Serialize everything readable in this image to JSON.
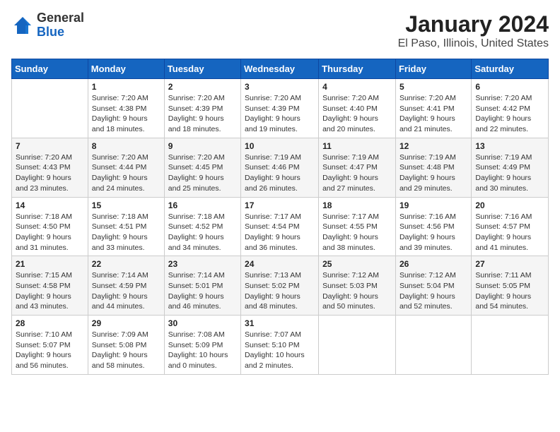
{
  "header": {
    "logo": {
      "general": "General",
      "blue": "Blue"
    },
    "title": "January 2024",
    "subtitle": "El Paso, Illinois, United States"
  },
  "weekdays": [
    "Sunday",
    "Monday",
    "Tuesday",
    "Wednesday",
    "Thursday",
    "Friday",
    "Saturday"
  ],
  "weeks": [
    [
      {
        "day": "",
        "sunrise": "",
        "sunset": "",
        "daylight": ""
      },
      {
        "day": "1",
        "sunrise": "Sunrise: 7:20 AM",
        "sunset": "Sunset: 4:38 PM",
        "daylight": "Daylight: 9 hours and 18 minutes."
      },
      {
        "day": "2",
        "sunrise": "Sunrise: 7:20 AM",
        "sunset": "Sunset: 4:39 PM",
        "daylight": "Daylight: 9 hours and 18 minutes."
      },
      {
        "day": "3",
        "sunrise": "Sunrise: 7:20 AM",
        "sunset": "Sunset: 4:39 PM",
        "daylight": "Daylight: 9 hours and 19 minutes."
      },
      {
        "day": "4",
        "sunrise": "Sunrise: 7:20 AM",
        "sunset": "Sunset: 4:40 PM",
        "daylight": "Daylight: 9 hours and 20 minutes."
      },
      {
        "day": "5",
        "sunrise": "Sunrise: 7:20 AM",
        "sunset": "Sunset: 4:41 PM",
        "daylight": "Daylight: 9 hours and 21 minutes."
      },
      {
        "day": "6",
        "sunrise": "Sunrise: 7:20 AM",
        "sunset": "Sunset: 4:42 PM",
        "daylight": "Daylight: 9 hours and 22 minutes."
      }
    ],
    [
      {
        "day": "7",
        "sunrise": "Sunrise: 7:20 AM",
        "sunset": "Sunset: 4:43 PM",
        "daylight": "Daylight: 9 hours and 23 minutes."
      },
      {
        "day": "8",
        "sunrise": "Sunrise: 7:20 AM",
        "sunset": "Sunset: 4:44 PM",
        "daylight": "Daylight: 9 hours and 24 minutes."
      },
      {
        "day": "9",
        "sunrise": "Sunrise: 7:20 AM",
        "sunset": "Sunset: 4:45 PM",
        "daylight": "Daylight: 9 hours and 25 minutes."
      },
      {
        "day": "10",
        "sunrise": "Sunrise: 7:19 AM",
        "sunset": "Sunset: 4:46 PM",
        "daylight": "Daylight: 9 hours and 26 minutes."
      },
      {
        "day": "11",
        "sunrise": "Sunrise: 7:19 AM",
        "sunset": "Sunset: 4:47 PM",
        "daylight": "Daylight: 9 hours and 27 minutes."
      },
      {
        "day": "12",
        "sunrise": "Sunrise: 7:19 AM",
        "sunset": "Sunset: 4:48 PM",
        "daylight": "Daylight: 9 hours and 29 minutes."
      },
      {
        "day": "13",
        "sunrise": "Sunrise: 7:19 AM",
        "sunset": "Sunset: 4:49 PM",
        "daylight": "Daylight: 9 hours and 30 minutes."
      }
    ],
    [
      {
        "day": "14",
        "sunrise": "Sunrise: 7:18 AM",
        "sunset": "Sunset: 4:50 PM",
        "daylight": "Daylight: 9 hours and 31 minutes."
      },
      {
        "day": "15",
        "sunrise": "Sunrise: 7:18 AM",
        "sunset": "Sunset: 4:51 PM",
        "daylight": "Daylight: 9 hours and 33 minutes."
      },
      {
        "day": "16",
        "sunrise": "Sunrise: 7:18 AM",
        "sunset": "Sunset: 4:52 PM",
        "daylight": "Daylight: 9 hours and 34 minutes."
      },
      {
        "day": "17",
        "sunrise": "Sunrise: 7:17 AM",
        "sunset": "Sunset: 4:54 PM",
        "daylight": "Daylight: 9 hours and 36 minutes."
      },
      {
        "day": "18",
        "sunrise": "Sunrise: 7:17 AM",
        "sunset": "Sunset: 4:55 PM",
        "daylight": "Daylight: 9 hours and 38 minutes."
      },
      {
        "day": "19",
        "sunrise": "Sunrise: 7:16 AM",
        "sunset": "Sunset: 4:56 PM",
        "daylight": "Daylight: 9 hours and 39 minutes."
      },
      {
        "day": "20",
        "sunrise": "Sunrise: 7:16 AM",
        "sunset": "Sunset: 4:57 PM",
        "daylight": "Daylight: 9 hours and 41 minutes."
      }
    ],
    [
      {
        "day": "21",
        "sunrise": "Sunrise: 7:15 AM",
        "sunset": "Sunset: 4:58 PM",
        "daylight": "Daylight: 9 hours and 43 minutes."
      },
      {
        "day": "22",
        "sunrise": "Sunrise: 7:14 AM",
        "sunset": "Sunset: 4:59 PM",
        "daylight": "Daylight: 9 hours and 44 minutes."
      },
      {
        "day": "23",
        "sunrise": "Sunrise: 7:14 AM",
        "sunset": "Sunset: 5:01 PM",
        "daylight": "Daylight: 9 hours and 46 minutes."
      },
      {
        "day": "24",
        "sunrise": "Sunrise: 7:13 AM",
        "sunset": "Sunset: 5:02 PM",
        "daylight": "Daylight: 9 hours and 48 minutes."
      },
      {
        "day": "25",
        "sunrise": "Sunrise: 7:12 AM",
        "sunset": "Sunset: 5:03 PM",
        "daylight": "Daylight: 9 hours and 50 minutes."
      },
      {
        "day": "26",
        "sunrise": "Sunrise: 7:12 AM",
        "sunset": "Sunset: 5:04 PM",
        "daylight": "Daylight: 9 hours and 52 minutes."
      },
      {
        "day": "27",
        "sunrise": "Sunrise: 7:11 AM",
        "sunset": "Sunset: 5:05 PM",
        "daylight": "Daylight: 9 hours and 54 minutes."
      }
    ],
    [
      {
        "day": "28",
        "sunrise": "Sunrise: 7:10 AM",
        "sunset": "Sunset: 5:07 PM",
        "daylight": "Daylight: 9 hours and 56 minutes."
      },
      {
        "day": "29",
        "sunrise": "Sunrise: 7:09 AM",
        "sunset": "Sunset: 5:08 PM",
        "daylight": "Daylight: 9 hours and 58 minutes."
      },
      {
        "day": "30",
        "sunrise": "Sunrise: 7:08 AM",
        "sunset": "Sunset: 5:09 PM",
        "daylight": "Daylight: 10 hours and 0 minutes."
      },
      {
        "day": "31",
        "sunrise": "Sunrise: 7:07 AM",
        "sunset": "Sunset: 5:10 PM",
        "daylight": "Daylight: 10 hours and 2 minutes."
      },
      {
        "day": "",
        "sunrise": "",
        "sunset": "",
        "daylight": ""
      },
      {
        "day": "",
        "sunrise": "",
        "sunset": "",
        "daylight": ""
      },
      {
        "day": "",
        "sunrise": "",
        "sunset": "",
        "daylight": ""
      }
    ]
  ]
}
